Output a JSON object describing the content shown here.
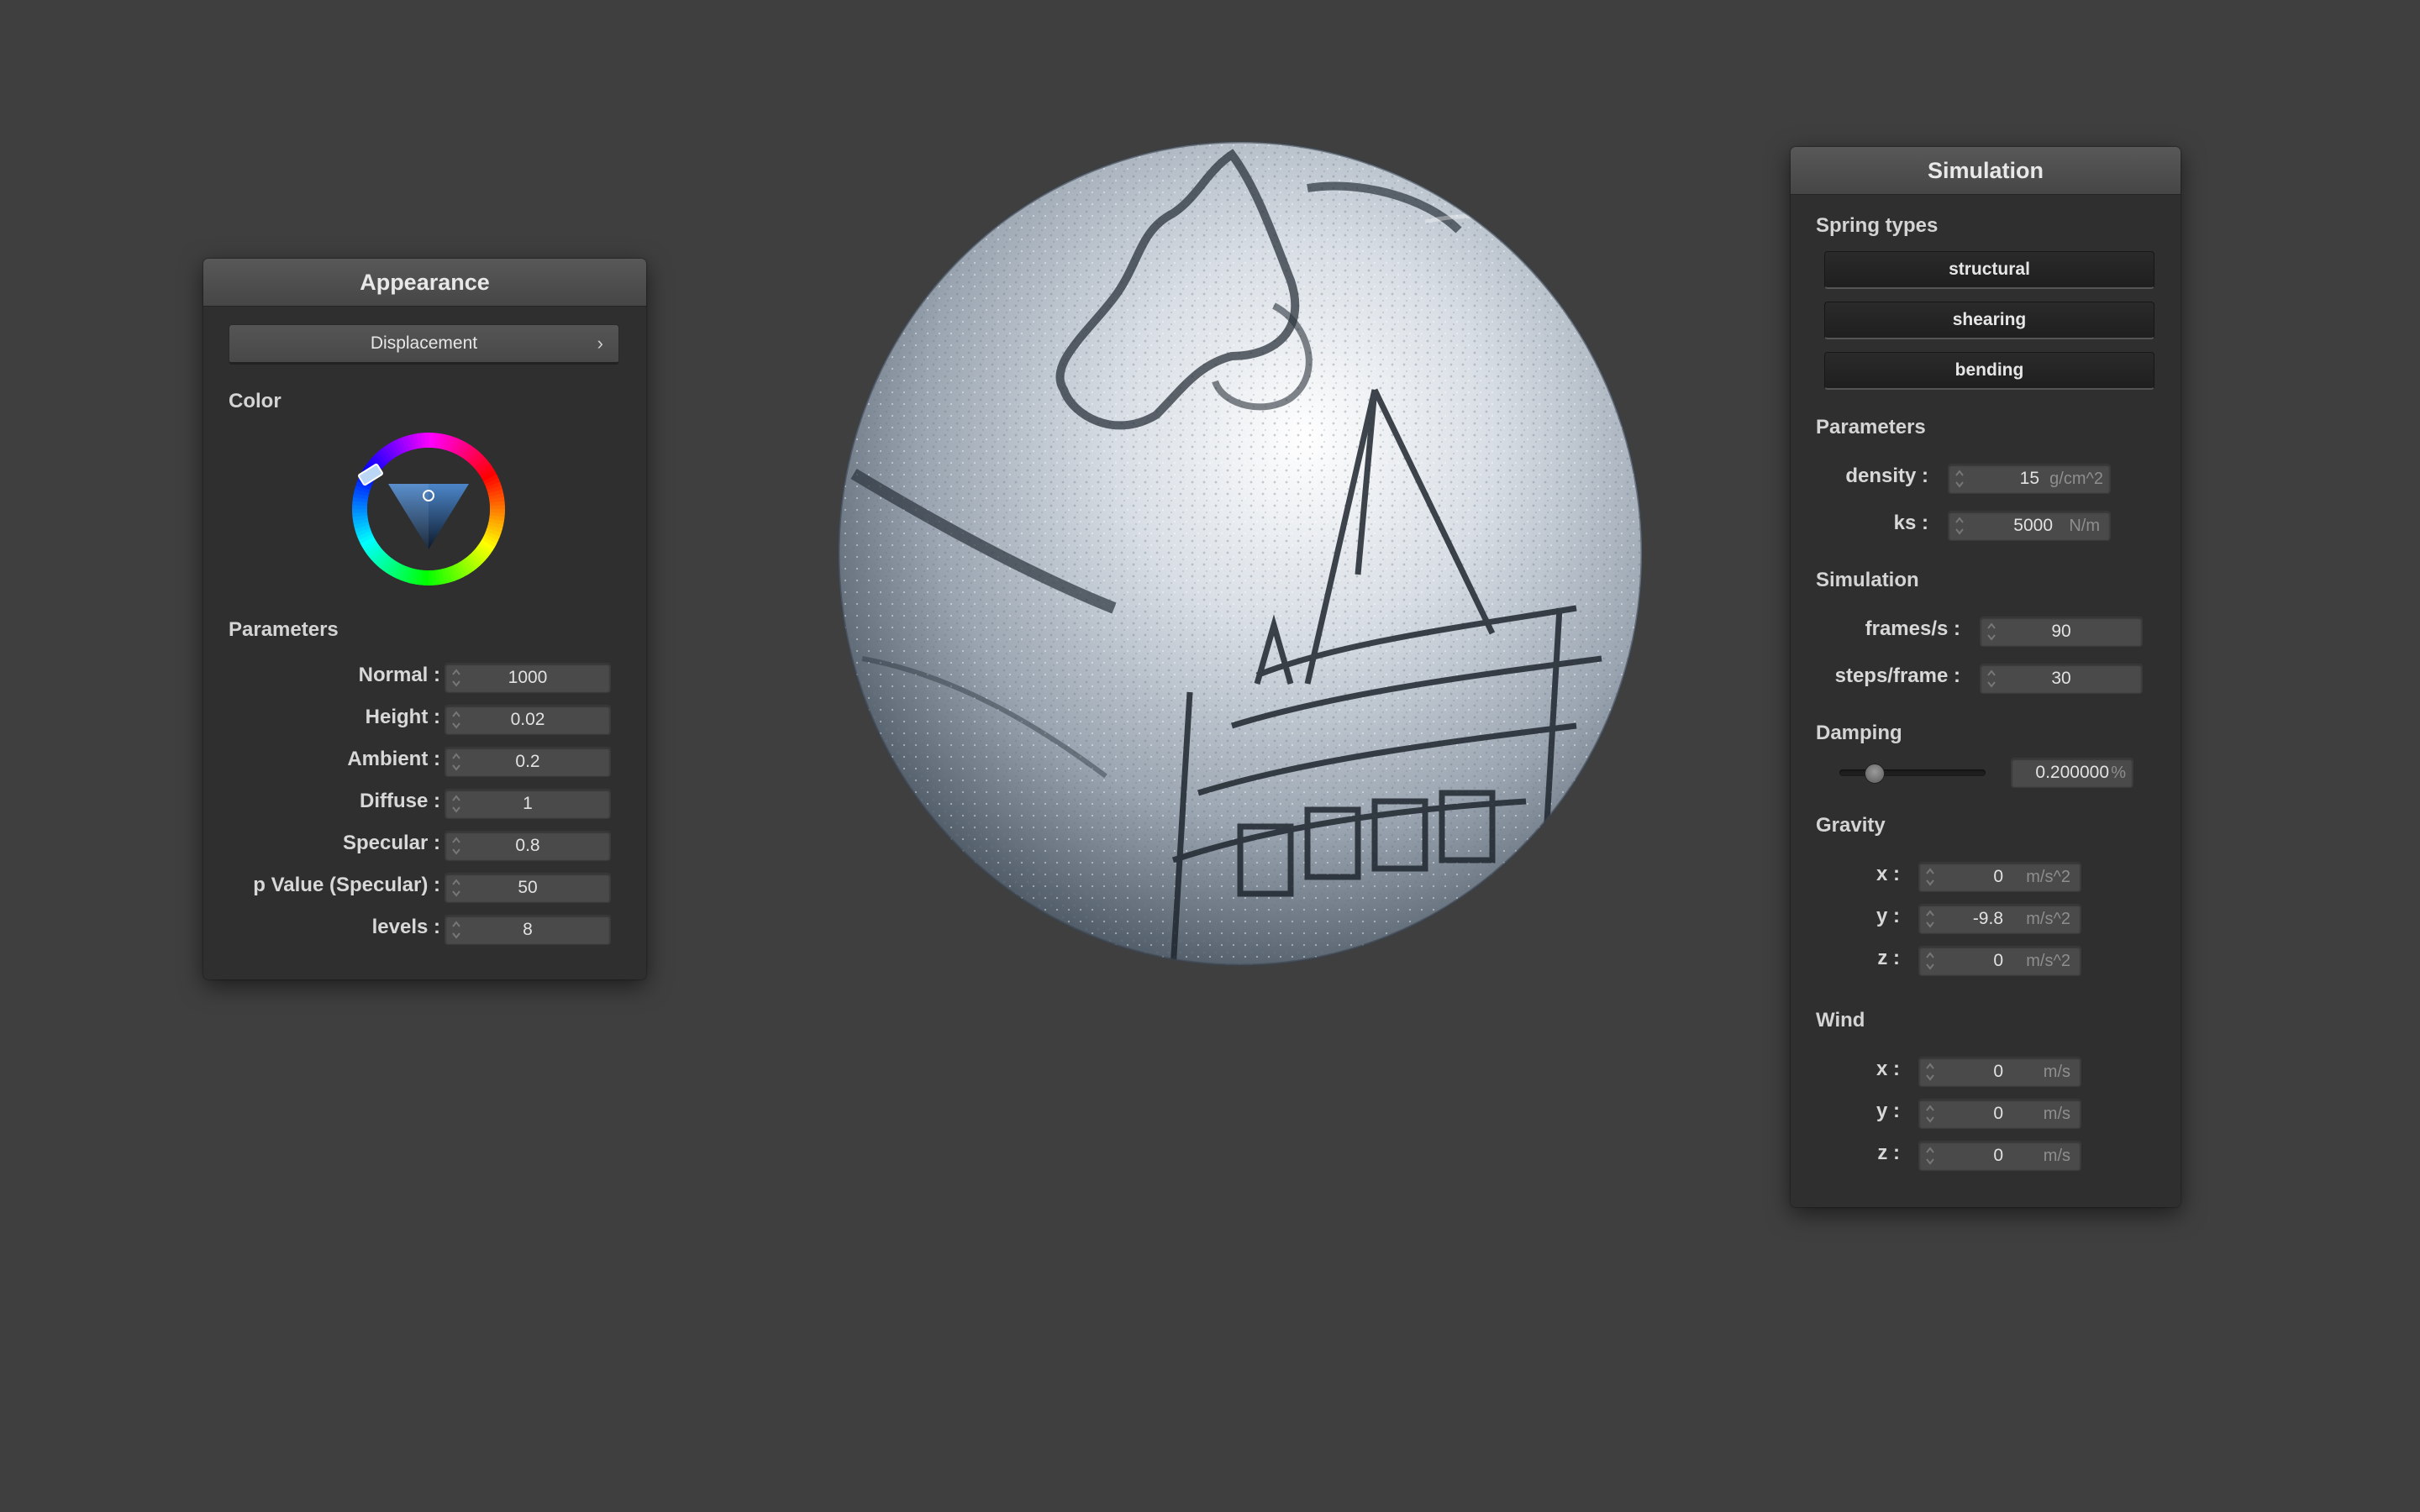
{
  "appearance": {
    "title": "Appearance",
    "mode_label": "Displacement",
    "color_label": "Color",
    "parameters_label": "Parameters",
    "params": [
      {
        "label": "Normal :",
        "value": "1000"
      },
      {
        "label": "Height :",
        "value": "0.02"
      },
      {
        "label": "Ambient :",
        "value": "0.2"
      },
      {
        "label": "Diffuse :",
        "value": "1"
      },
      {
        "label": "Specular :",
        "value": "0.8"
      },
      {
        "label": "p Value (Specular) :",
        "value": "50"
      },
      {
        "label": "levels :",
        "value": "8"
      }
    ],
    "color_hex": "#3a6fb0"
  },
  "simulation": {
    "title": "Simulation",
    "spring_types_label": "Spring types",
    "spring_buttons": [
      "structural",
      "shearing",
      "bending"
    ],
    "parameters_label": "Parameters",
    "density": {
      "label": "density :",
      "value": "15",
      "unit": "g/cm^2"
    },
    "ks": {
      "label": "ks :",
      "value": "5000",
      "unit": "N/m"
    },
    "simulation_label": "Simulation",
    "frames": {
      "label": "frames/s :",
      "value": "90"
    },
    "steps": {
      "label": "steps/frame :",
      "value": "30"
    },
    "damping_label": "Damping",
    "damping": {
      "value": "0.200000",
      "unit": "%",
      "slider_fraction": 0.2
    },
    "gravity_label": "Gravity",
    "gravity": [
      {
        "label": "x :",
        "value": "0",
        "unit": "m/s^2"
      },
      {
        "label": "y :",
        "value": "-9.8",
        "unit": "m/s^2"
      },
      {
        "label": "z :",
        "value": "0",
        "unit": "m/s^2"
      }
    ],
    "wind_label": "Wind",
    "wind": [
      {
        "label": "x :",
        "value": "0",
        "unit": "m/s"
      },
      {
        "label": "y :",
        "value": "0",
        "unit": "m/s"
      },
      {
        "label": "z :",
        "value": "0",
        "unit": "m/s"
      }
    ]
  },
  "colors": {
    "background": "#3f3f3f",
    "panel": "#2f2f2f",
    "header": "#4e4e4e"
  }
}
